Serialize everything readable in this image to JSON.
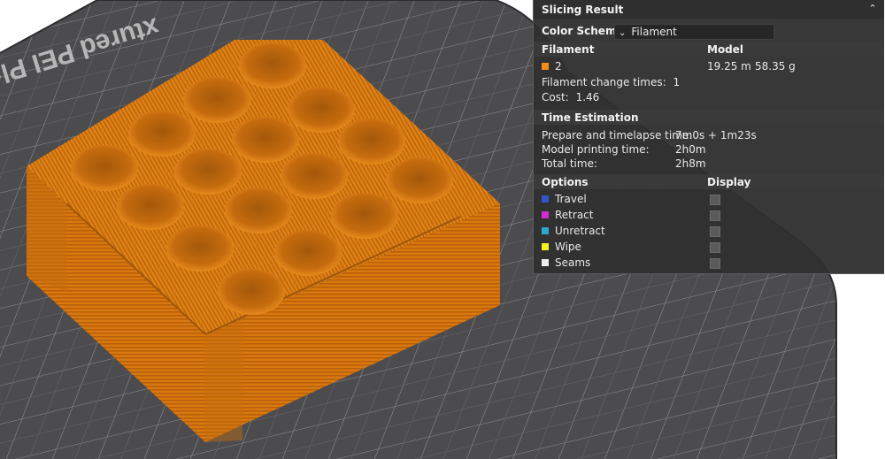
{
  "plate": {
    "label": "xtured PEI Plate"
  },
  "panel": {
    "title": "Slicing Result",
    "collapse_icon": "double-chevron-up-icon",
    "color_scheme_label": "Color Scheme",
    "color_scheme_value": "Filament",
    "filament_header": "Filament",
    "model_header": "Model",
    "filament_id": "2",
    "filament_color": "#f28c1c",
    "filament_length": "19.25 m",
    "filament_weight": "58.35 g",
    "change_times_label": "Filament change times:",
    "change_times_value": "1",
    "cost_label": "Cost:",
    "cost_value": "1.46",
    "time_header": "Time Estimation",
    "prepare_label": "Prepare and timelapse time:",
    "prepare_value": "7m0s + 1m23s",
    "model_time_label": "Model printing time:",
    "model_time_value": "2h0m",
    "total_label": "Total time:",
    "total_value": "2h8m",
    "options_header": "Options",
    "display_header": "Display",
    "options": [
      {
        "label": "Travel",
        "color": "#2f55c8"
      },
      {
        "label": "Retract",
        "color": "#d12bd1"
      },
      {
        "label": "Unretract",
        "color": "#2fa7cf"
      },
      {
        "label": "Wipe",
        "color": "#f2f21c"
      },
      {
        "label": "Seams",
        "color": "#eeeeee"
      }
    ]
  }
}
